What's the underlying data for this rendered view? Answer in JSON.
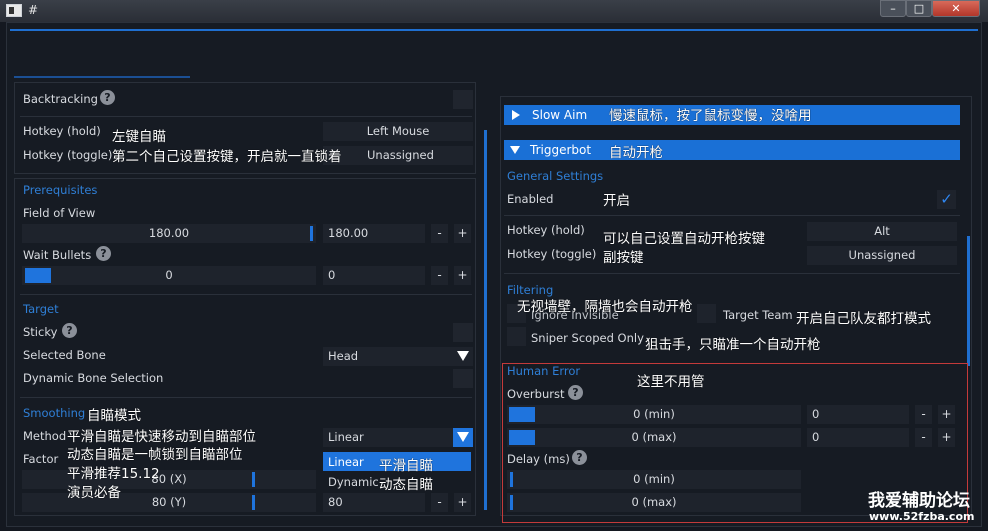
{
  "window": {
    "title": "#",
    "min_glyph": "–",
    "max_glyph": "□",
    "close_glyph": "✕"
  },
  "left": {
    "backtracking": "Backtracking",
    "hotkey_hold": "Hotkey (hold)",
    "hotkey_hold_value": "Left Mouse",
    "hotkey_toggle": "Hotkey (toggle)",
    "hotkey_toggle_value": "Unassigned",
    "prerequisites": "Prerequisites",
    "field_of_view": "Field of View",
    "fov_slider": "180.00",
    "fov_input": "180.00",
    "fov_fraction": 1.0,
    "wait_bullets": "Wait Bullets",
    "wait_slider": "0",
    "wait_input": "0",
    "target": "Target",
    "sticky": "Sticky",
    "selected_bone": "Selected Bone",
    "selected_bone_value": "Head",
    "dynamic_bone": "Dynamic Bone Selection",
    "smoothing": "Smoothing",
    "method": "Method",
    "method_value": "Linear",
    "factor": "Factor",
    "option_linear": "Linear",
    "option_dynamic": "Dynamic",
    "factor_x": "80 (X)",
    "factor_y": "80 (Y)",
    "factor_y_input": "80",
    "minus": "-",
    "plus": "+"
  },
  "right": {
    "slow_aim": "Slow Aim",
    "triggerbot": "Triggerbot",
    "general_settings": "General Settings",
    "enabled": "Enabled",
    "checkmark": "✓",
    "hotkey_hold": "Hotkey (hold)",
    "hotkey_hold_value": "Alt",
    "hotkey_toggle": "Hotkey (toggle)",
    "hotkey_toggle_value": "Unassigned",
    "filtering": "Filtering",
    "ignore_invisible": "Ignore Invisible",
    "target_team": "Target Team",
    "sniper_scoped_only": "Sniper Scoped Only",
    "human_error": "Human Error",
    "overburst": "Overburst",
    "overburst_min": "0 (min)",
    "overburst_min_input": "0",
    "overburst_max": "0 (max)",
    "overburst_max_input": "0",
    "delay": "Delay (ms)",
    "delay_min": "0 (min)",
    "delay_max": "0 (max)",
    "minus": "-",
    "plus": "+"
  },
  "notes": {
    "left_aim": "左键自瞄",
    "second_key": "第二个自己设置按键，开启就一直锁着",
    "aim_mode": "自瞄模式",
    "method_1": "平滑自瞄是快速移动到自瞄部位",
    "method_2": "动态自瞄是一帧锁到自瞄部位",
    "method_3": "平滑推荐15.12",
    "method_4": "演员必备",
    "smooth_aim": "平滑自瞄",
    "dynamic_aim": "动态自瞄",
    "slow_aim": "慢速鼠标，按了鼠标变慢，没啥用",
    "auto_fire": "自动开枪",
    "on": "开启",
    "set_key": "可以自己设置自动开枪按键",
    "sub_key": "副按键",
    "wall": "无视墙壁，隔墙也会自动开枪",
    "team": "开启自己队友都打模式",
    "sniper": "狙击手，只瞄准一个自动开枪",
    "ignore": "这里不用管"
  },
  "watermark": {
    "line1": "我爱辅助论坛",
    "line2": "www.52fzba.com"
  }
}
